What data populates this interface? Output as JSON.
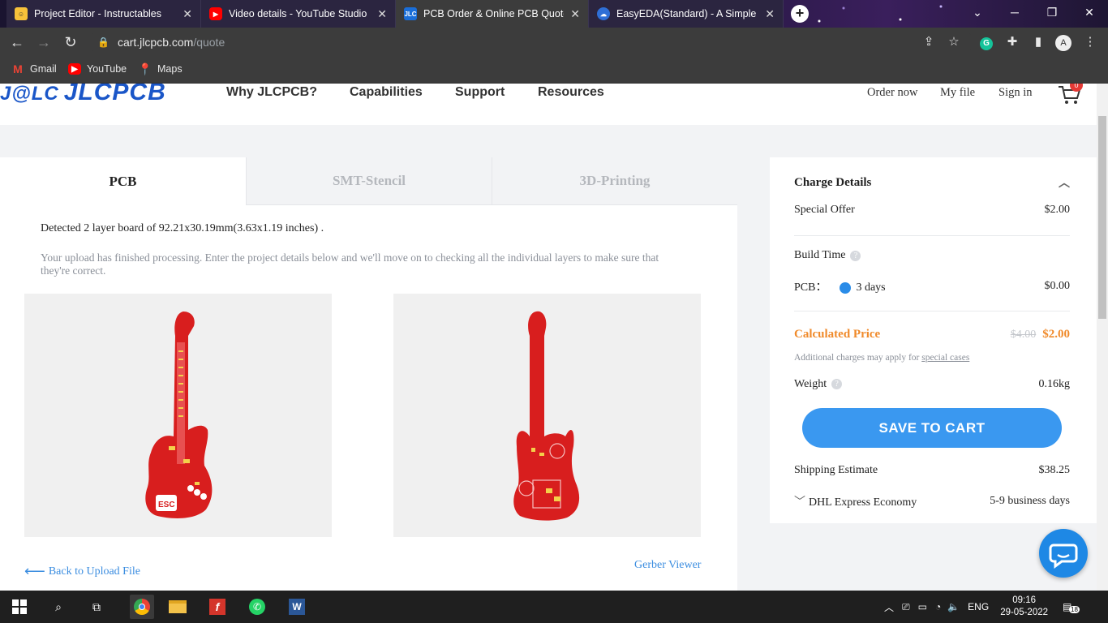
{
  "browser": {
    "tabs": [
      {
        "title": "Project Editor - Instructables",
        "active": false
      },
      {
        "title": "Video details - YouTube Studio",
        "active": false
      },
      {
        "title": "PCB Order & Online PCB Quote & PCB",
        "active": true
      },
      {
        "title": "EasyEDA(Standard) - A Simple and Powerful",
        "active": false
      }
    ],
    "url_host": "cart.jlcpcb.com",
    "url_path": "/quote",
    "bookmarks": [
      "Gmail",
      "YouTube",
      "Maps"
    ]
  },
  "header": {
    "logo_icon": "J@LC",
    "logo_text": "JLCPCB",
    "nav": [
      "Why JLCPCB?",
      "Capabilities",
      "Support",
      "Resources"
    ],
    "links": [
      "Order now",
      "My file",
      "Sign in"
    ],
    "cart_count": "0"
  },
  "left": {
    "tabs": [
      "PCB",
      "SMT-Stencil",
      "3D-Printing"
    ],
    "detected": "Detected 2 layer board of 92.21x30.19mm(3.63x1.19 inches) .",
    "finished": "Your upload has finished processing. Enter the project details below and we'll move on to checking all the individual layers to make sure that they're correct.",
    "back_link": "Back to Upload File",
    "gerber_viewer": "Gerber Viewer"
  },
  "charge": {
    "title": "Charge Details",
    "special_offer_label": "Special Offer",
    "special_offer_value": "$2.00",
    "build_time_label": "Build Time",
    "pcb_label": "PCB：",
    "pcb_days": "3 days",
    "pcb_value": "$0.00",
    "calculated_label": "Calculated Price",
    "old_price": "$4.00",
    "new_price": "$2.00",
    "additional_text": "Additional charges may apply for",
    "special_cases": "special cases",
    "weight_label": "Weight",
    "weight_value": "0.16kg",
    "save_button": "SAVE TO CART",
    "shipping_label": "Shipping Estimate",
    "shipping_value": "$38.25",
    "dhl_label": "DHL Express Economy",
    "dhl_days": "5-9 business days"
  },
  "taskbar": {
    "lang": "ENG",
    "time": "09:16",
    "date": "29-05-2022",
    "notif_count": "18"
  },
  "colors": {
    "accent_blue": "#3a98f0",
    "price_orange": "#f08a2a",
    "pcb_red": "#d81e1e"
  }
}
